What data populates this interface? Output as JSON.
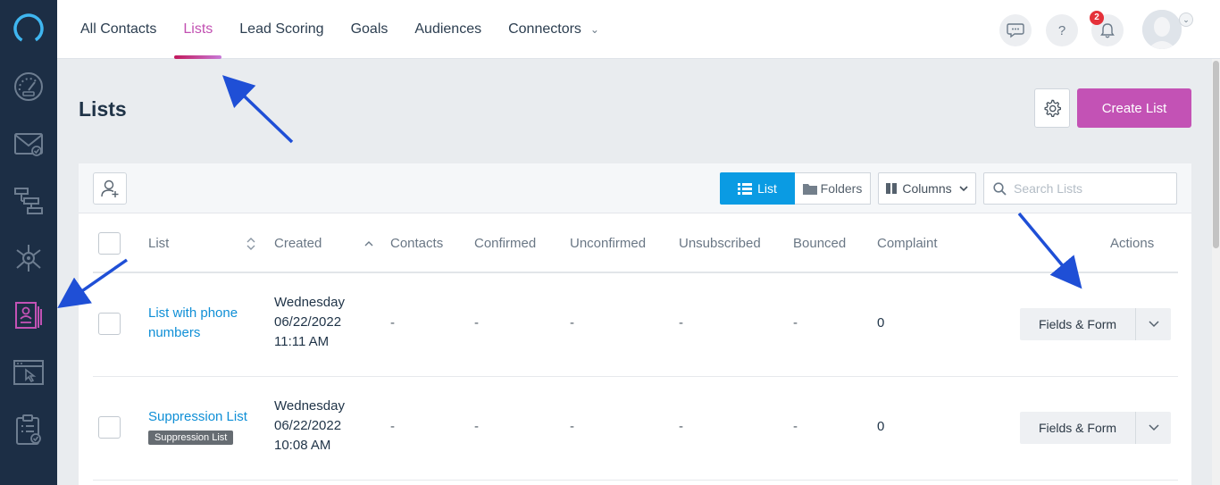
{
  "nav": {
    "tabs": [
      {
        "label": "All Contacts"
      },
      {
        "label": "Lists"
      },
      {
        "label": "Lead Scoring"
      },
      {
        "label": "Goals"
      },
      {
        "label": "Audiences"
      },
      {
        "label": "Connectors"
      }
    ],
    "active_tab": "Lists",
    "notification_count": "2",
    "help_label": "?"
  },
  "sidebar": {
    "icons": [
      "logo-icon",
      "dashboard-icon",
      "campaigns-icon",
      "automations-icon",
      "contacts-network-icon",
      "lists-icon",
      "site-tracking-icon",
      "reports-icon"
    ],
    "active": "lists-icon"
  },
  "page": {
    "title": "Lists",
    "create_label": "Create List"
  },
  "toolbar": {
    "list_view_label": "List",
    "folders_view_label": "Folders",
    "columns_label": "Columns",
    "search_placeholder": "Search Lists"
  },
  "table": {
    "headers": [
      "List",
      "Created",
      "Contacts",
      "Confirmed",
      "Unconfirmed",
      "Unsubscribed",
      "Bounced",
      "Complaint",
      "Actions"
    ],
    "rows": [
      {
        "name_line1": "List with phone",
        "name_line2": "numbers",
        "tag": "",
        "created_day": "Wednesday",
        "created_date": "06/22/2022",
        "created_time": "11:11 AM",
        "contacts": "-",
        "confirmed": "-",
        "unconfirmed": "-",
        "unsubscribed": "-",
        "bounced": "-",
        "complaint": "0",
        "action_label": "Fields & Form"
      },
      {
        "name_line1": "Suppression List",
        "name_line2": "",
        "tag": "Suppression List",
        "created_day": "Wednesday",
        "created_date": "06/22/2022",
        "created_time": "10:08 AM",
        "contacts": "-",
        "confirmed": "-",
        "unconfirmed": "-",
        "unsubscribed": "-",
        "bounced": "-",
        "complaint": "0",
        "action_label": "Fields & Form"
      }
    ]
  },
  "colors": {
    "accent": "#c352b5",
    "primary_blue": "#0a9be3",
    "rail": "#1c2e45",
    "annotation_arrow": "#1f4fd6"
  }
}
